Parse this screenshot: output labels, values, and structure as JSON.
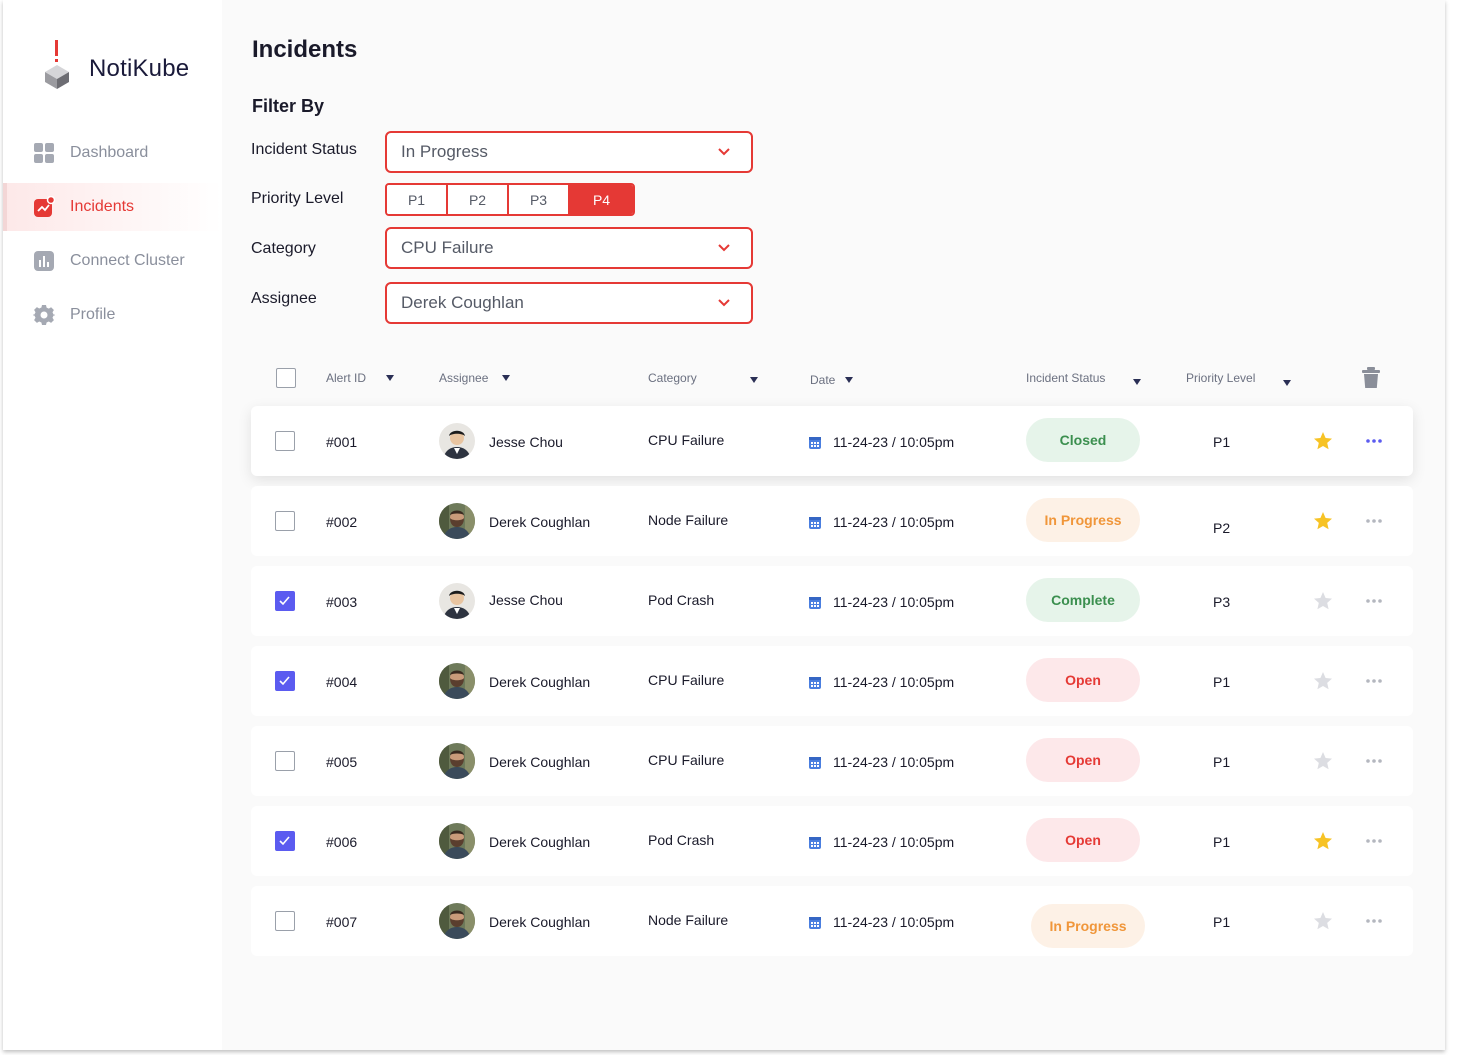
{
  "app": {
    "name": "NotiKube"
  },
  "sidebar": {
    "items": [
      {
        "label": "Dashboard",
        "icon": "dashboard-grid-icon",
        "active": false
      },
      {
        "label": "Incidents",
        "icon": "incidents-chart-icon",
        "active": true
      },
      {
        "label": "Connect Cluster",
        "icon": "bar-chart-icon",
        "active": false
      },
      {
        "label": "Profile",
        "icon": "gear-icon",
        "active": false
      }
    ]
  },
  "page": {
    "title": "Incidents"
  },
  "filters": {
    "title": "Filter By",
    "status_label": "Incident Status",
    "status_value": "In Progress",
    "priority_label": "Priority Level",
    "priority_options": [
      "P1",
      "P2",
      "P3",
      "P4"
    ],
    "priority_selected": "P4",
    "category_label": "Category",
    "category_value": "CPU Failure",
    "assignee_label": "Assignee",
    "assignee_value": "Derek Coughlan"
  },
  "table": {
    "headers": {
      "alert_id": "Alert ID",
      "assignee": "Assignee",
      "category": "Category",
      "date": "Date",
      "status": "Incident Status",
      "priority": "Priority Level"
    },
    "rows": [
      {
        "id": "#001",
        "assignee": "Jesse Chou",
        "avatar": "jesse",
        "category": "CPU Failure",
        "date": "11-24-23 / 10:05pm",
        "status": "Closed",
        "status_kind": "closed",
        "priority": "P1",
        "checked": false,
        "starred": true,
        "menu_active": true
      },
      {
        "id": "#002",
        "assignee": "Derek Coughlan",
        "avatar": "derek",
        "category": "Node Failure",
        "date": "11-24-23 / 10:05pm",
        "status": "In Progress",
        "status_kind": "inprogress",
        "priority": "P2",
        "checked": false,
        "starred": true,
        "menu_active": false
      },
      {
        "id": "#003",
        "assignee": "Jesse Chou",
        "avatar": "jesse",
        "category": "Pod Crash",
        "date": "11-24-23 / 10:05pm",
        "status": "Complete",
        "status_kind": "complete",
        "priority": "P3",
        "checked": true,
        "starred": false,
        "menu_active": false
      },
      {
        "id": "#004",
        "assignee": "Derek Coughlan",
        "avatar": "derek",
        "category": "CPU Failure",
        "date": "11-24-23 / 10:05pm",
        "status": "Open",
        "status_kind": "open",
        "priority": "P1",
        "checked": true,
        "starred": false,
        "menu_active": false
      },
      {
        "id": "#005",
        "assignee": "Derek Coughlan",
        "avatar": "derek",
        "category": "CPU Failure",
        "date": "11-24-23 / 10:05pm",
        "status": "Open",
        "status_kind": "open",
        "priority": "P1",
        "checked": false,
        "starred": false,
        "menu_active": false
      },
      {
        "id": "#006",
        "assignee": "Derek Coughlan",
        "avatar": "derek",
        "category": "Pod Crash",
        "date": "11-24-23 / 10:05pm",
        "status": "Open",
        "status_kind": "open",
        "priority": "P1",
        "checked": true,
        "starred": true,
        "menu_active": false
      },
      {
        "id": "#007",
        "assignee": "Derek Coughlan",
        "avatar": "derek",
        "category": "Node Failure",
        "date": "11-24-23 / 10:05pm",
        "status": "In Progress",
        "status_kind": "inprogress",
        "priority": "P1",
        "checked": false,
        "starred": false,
        "menu_active": false
      }
    ]
  },
  "colors": {
    "accent": "#e53935",
    "checkbox_checked": "#5b5bf0",
    "star_active": "#f7c325",
    "star_inactive": "#dcdde2"
  }
}
